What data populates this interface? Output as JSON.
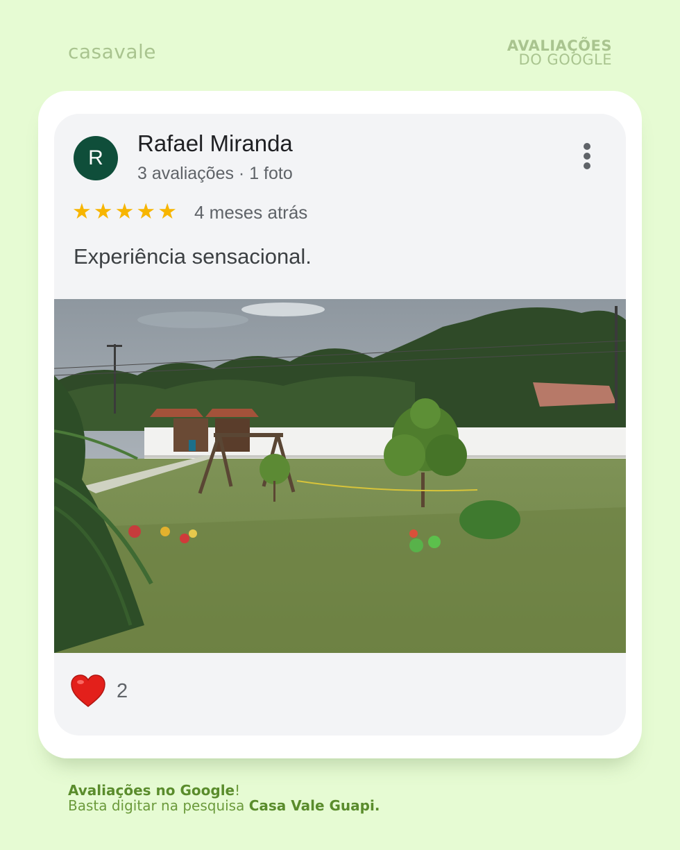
{
  "header": {
    "brand": "casavale",
    "badge_line1": "AVALIAÇÕES",
    "badge_line2": "DO GOOGLE"
  },
  "review": {
    "avatar_letter": "R",
    "reviewer_name": "Rafael Miranda",
    "reviewer_meta": "3 avaliações · 1 foto",
    "rating": 5,
    "time_ago": "4 meses atrás",
    "text": "Experiência sensacional.",
    "likes": "2",
    "more_icon": "more-vertical-icon",
    "like_icon": "heart-icon",
    "star_color": "#f7b500",
    "avatar_color": "#0f4e3a"
  },
  "footer": {
    "cta_bold": "Avaliações no Google",
    "cta_suffix": "!",
    "line2_prefix": "Basta digitar na pesquisa ",
    "line2_bold": "Casa Vale Guapi."
  },
  "colors": {
    "background": "#e6fbd3",
    "accent": "#5a8c2c"
  }
}
